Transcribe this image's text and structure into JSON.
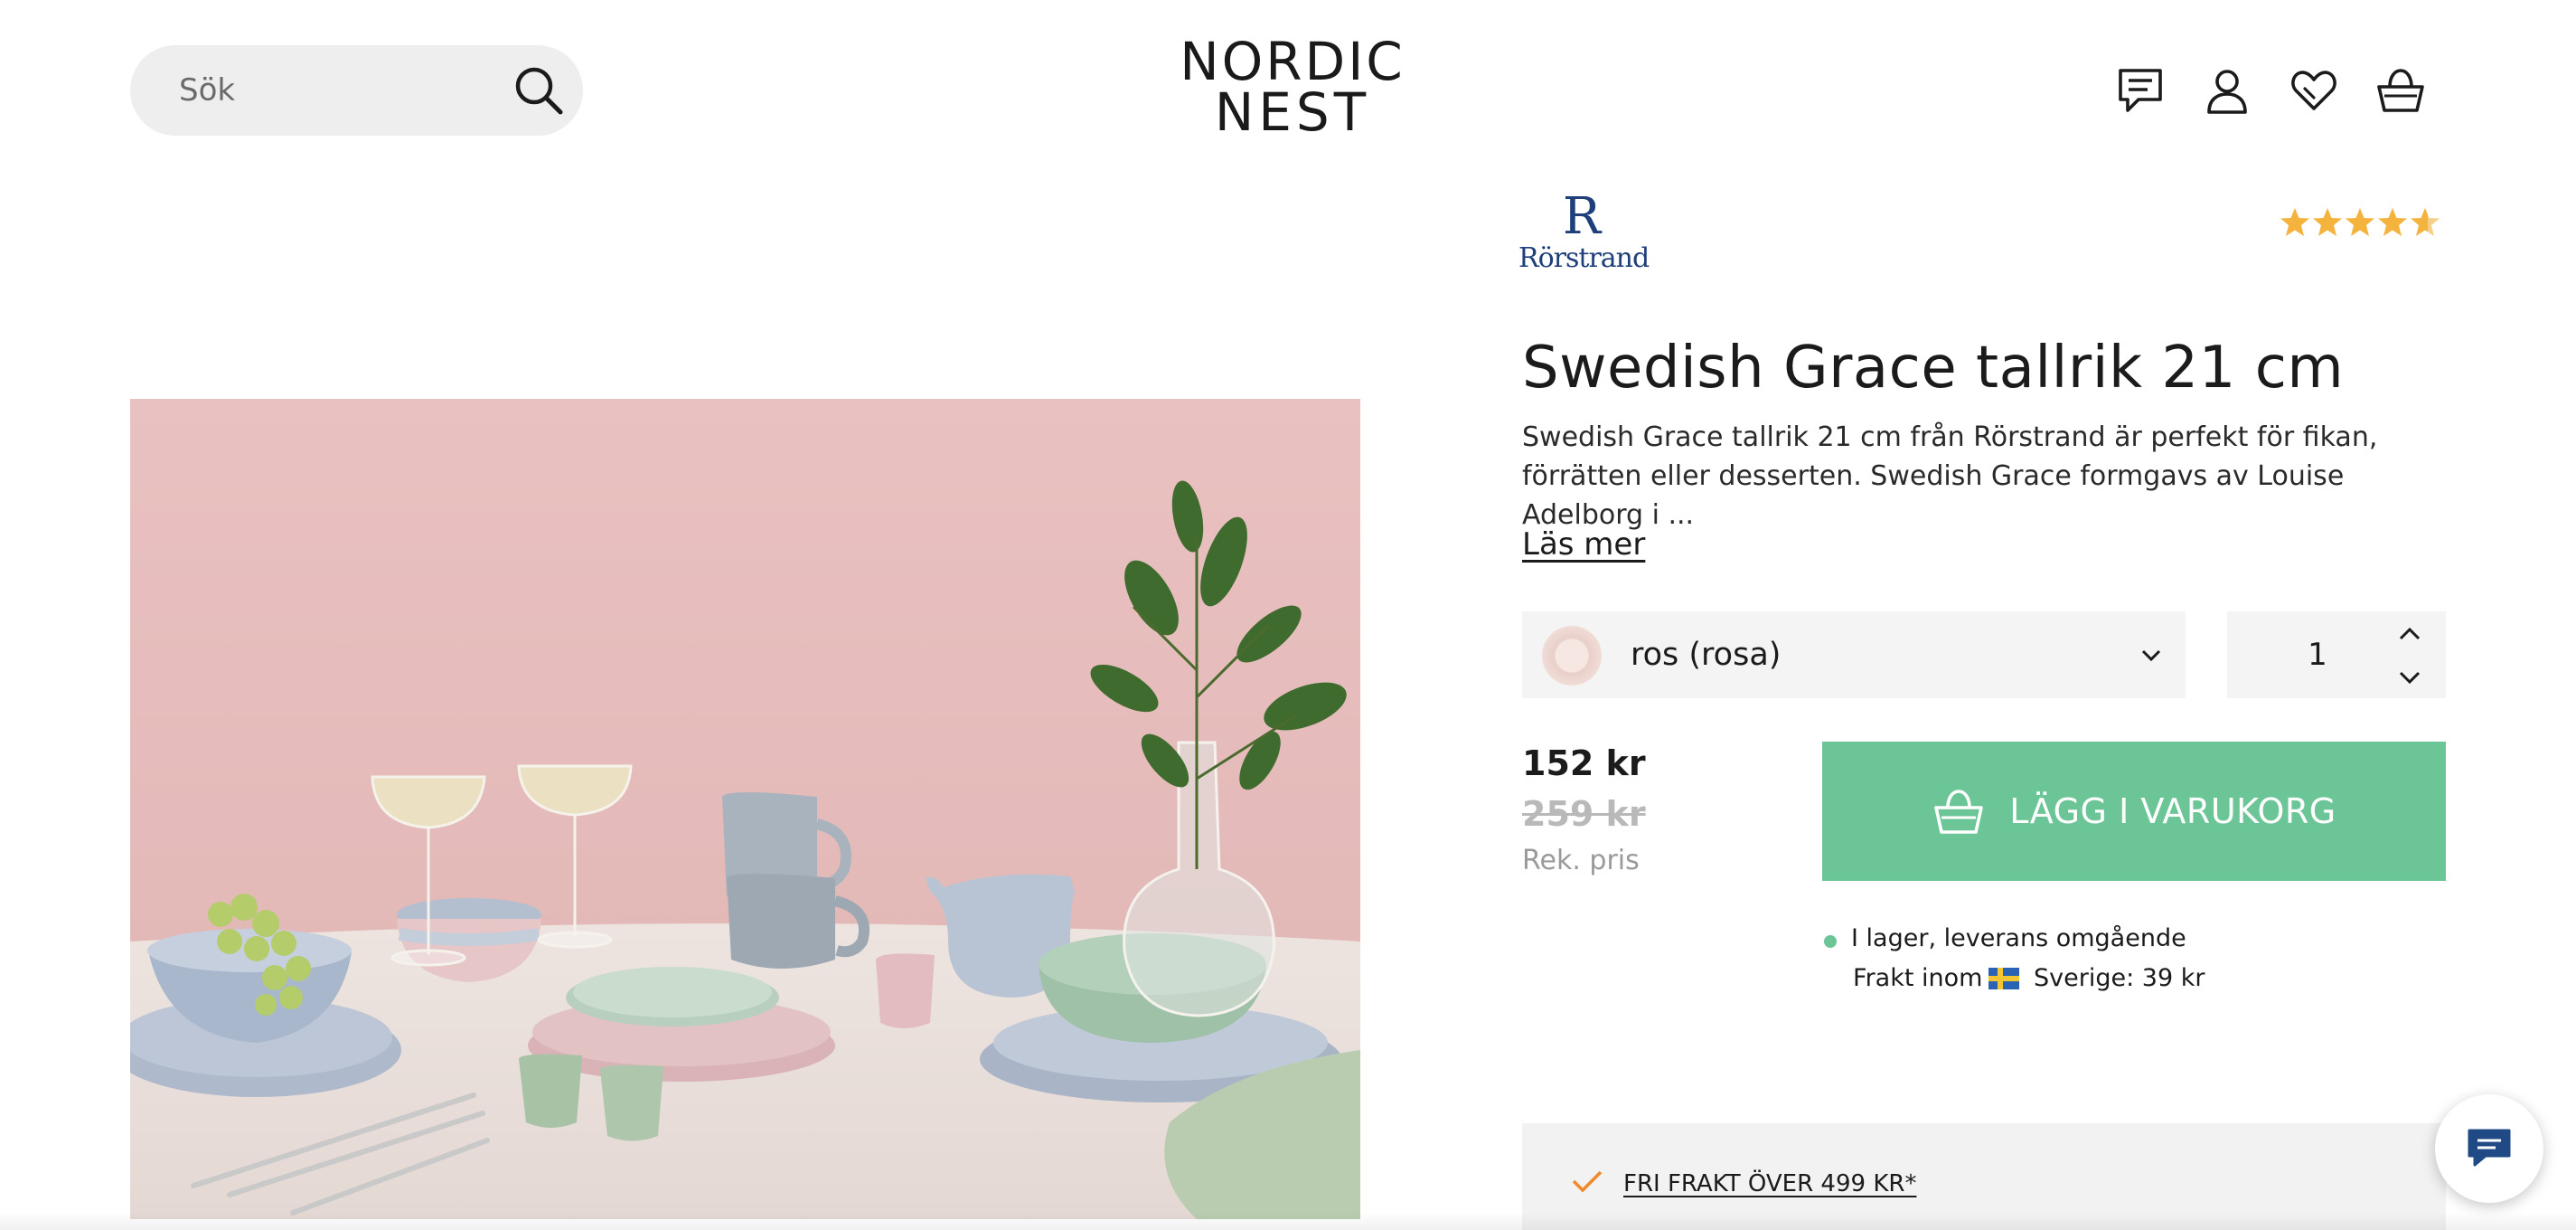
{
  "header": {
    "search_placeholder": "Sök",
    "logo_line1": "NORDIC",
    "logo_line2": "NEST",
    "icons": [
      "chat-icon",
      "account-icon",
      "wishlist-icon",
      "basket-icon"
    ]
  },
  "product": {
    "brand": "Rörstrand",
    "brand_mark": "R",
    "rating": 4.5,
    "rating_color": "#f3b33d",
    "title": "Swedish Grace tallrik 21 cm",
    "description": "Swedish Grace tallrik 21 cm från Rörstrand är perfekt för fikan, förrätten eller desserten. Swedish Grace formgavs av Louise Adelborg i ...",
    "read_more": "Läs mer",
    "variant": "ros (rosa)",
    "quantity": "1",
    "price": "152 kr",
    "old_price": "259 kr",
    "old_price_label": "Rek. pris",
    "add_to_cart": "LÄGG I VARUKORG",
    "accent_color": "#6cc596",
    "stock_status": "I lager, leverans omgående",
    "shipping_prefix": "Frakt inom",
    "shipping_country_price": "Sverige: 39 kr",
    "promo": "FRI FRAKT ÖVER 499 KR*"
  }
}
